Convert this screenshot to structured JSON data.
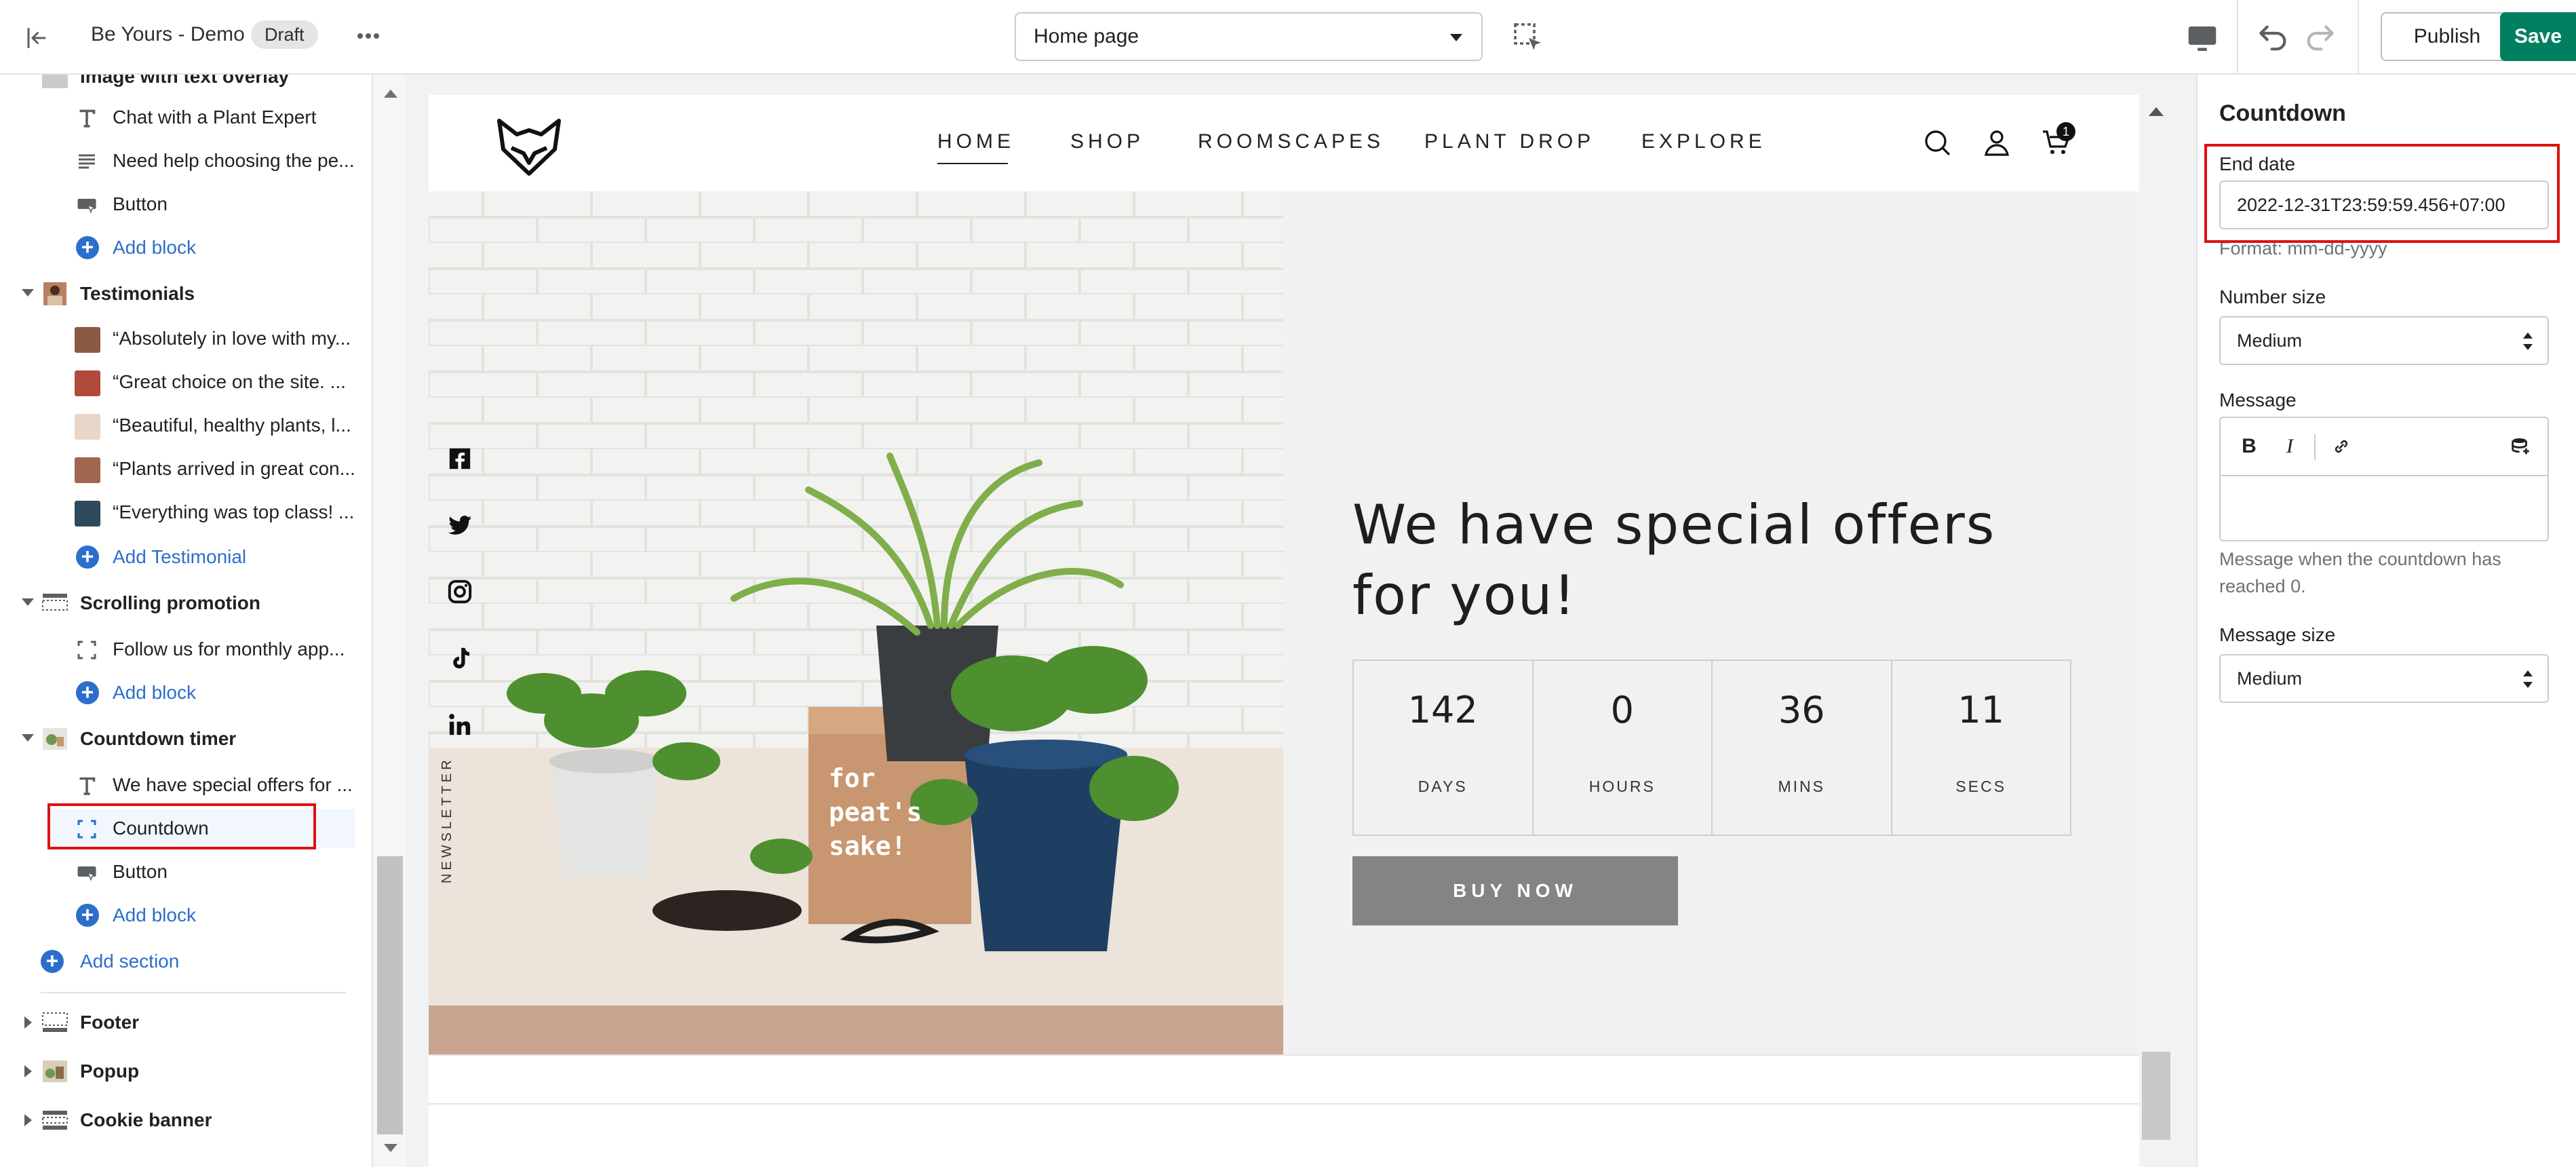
{
  "topbar": {
    "store_name": "Be Yours - Demo",
    "status_badge": "Draft",
    "page_select": "Home page",
    "publish_label": "Publish",
    "save_label": "Save"
  },
  "sidebar": {
    "partial_top_label": "Image with text overlay",
    "overlay_blocks": [
      {
        "label": "Chat with a Plant Expert",
        "icon": "text-icon"
      },
      {
        "label": "Need help choosing the pe...",
        "icon": "paragraph-icon"
      },
      {
        "label": "Button",
        "icon": "button-icon"
      }
    ],
    "add_block_label": "Add block",
    "testimonials": {
      "title": "Testimonials",
      "items": [
        "“Absolutely in love with my...",
        "“Great choice on the site. ...",
        "“Beautiful, healthy plants, l...",
        "“Plants arrived in great con...",
        "“Everything was top class! ..."
      ],
      "add_label": "Add Testimonial"
    },
    "scrolling_promotion": {
      "title": "Scrolling promotion",
      "items": [
        "Follow us for monthly app..."
      ]
    },
    "countdown_timer": {
      "title": "Countdown timer",
      "items": [
        {
          "label": "We have special offers for ...",
          "icon": "text-icon"
        },
        {
          "label": "Countdown",
          "icon": "countdown-icon"
        },
        {
          "label": "Button",
          "icon": "button-icon"
        }
      ]
    },
    "add_section_label": "Add section",
    "footer_sections": [
      "Footer",
      "Popup",
      "Cookie banner"
    ]
  },
  "preview": {
    "nav": [
      "HOME",
      "SHOP",
      "ROOMSCAPES",
      "PLANT DROP",
      "EXPLORE"
    ],
    "cart_count": "1",
    "social_icons": [
      "facebook-icon",
      "twitter-icon",
      "instagram-icon",
      "tiktok-icon",
      "linkedin-icon"
    ],
    "newsletter_label": "NEWSLETTER",
    "box_text_1": "for",
    "box_text_2": "peat's",
    "box_text_3": "sake!",
    "hero_title": "We have special offers for you!",
    "countdown": [
      {
        "value": "142",
        "label": "DAYS"
      },
      {
        "value": "0",
        "label": "HOURS"
      },
      {
        "value": "36",
        "label": "MINS"
      },
      {
        "value": "11",
        "label": "SECS"
      }
    ],
    "buy_label": "BUY NOW"
  },
  "settings": {
    "title": "Countdown",
    "end_date_label": "End date",
    "end_date_value": "2022-12-31T23:59:59.456+07:00",
    "end_date_help": "Format: mm-dd-yyyy",
    "number_size_label": "Number size",
    "number_size_value": "Medium",
    "message_label": "Message",
    "message_help": "Message when the countdown has reached 0.",
    "message_size_label": "Message size",
    "message_size_value": "Medium"
  },
  "colors": {
    "accent_blue": "#2c6ecb",
    "save_green": "#008060",
    "highlight_red": "#e01010",
    "buy_button_gray": "#848484"
  }
}
